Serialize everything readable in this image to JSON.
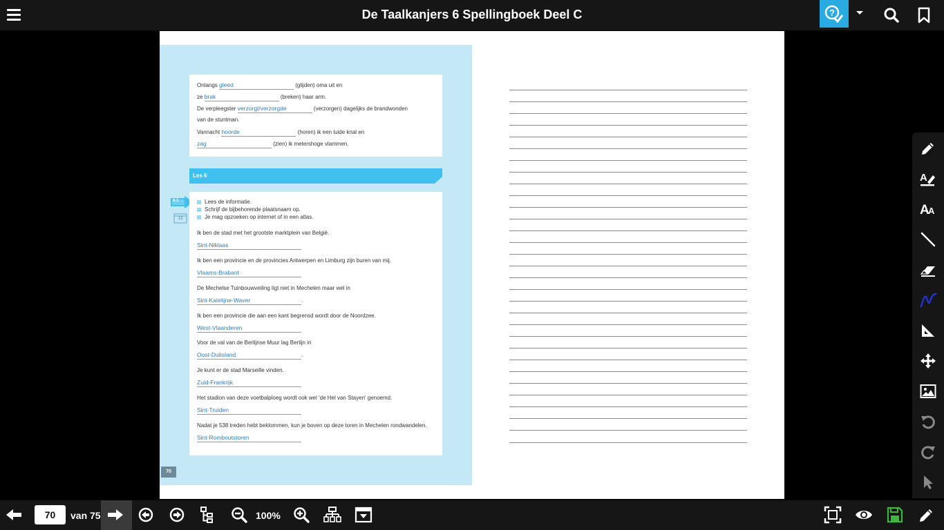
{
  "header": {
    "title": "De Taalkanjers 6 Spellingboek Deel C"
  },
  "footer": {
    "page_number": "70",
    "page_total_label": "van 75",
    "zoom_label": "100%"
  },
  "page_left": {
    "exercise_top": [
      {
        "pre": "Onlangs ",
        "answer": "gleed",
        "post": " (glijden) oma uit en"
      },
      {
        "pre": "ze ",
        "answer": "brak",
        "post": " (breken) haar arm."
      },
      {
        "pre": "De verpleegster ",
        "answer": "verzorgt/verzorgde",
        "post": " (verzorgen) dagelijks de brandwonden"
      },
      {
        "pre": "van de stuntman.",
        "answer": "",
        "post": ""
      },
      {
        "pre": "Vannacht ",
        "answer": "hoorde",
        "post": " (horen) ik een luide knal en"
      },
      {
        "pre": "",
        "answer": "zag",
        "post": " (zien) ik metershoge vlammen."
      }
    ],
    "lesson_title": "Les 6",
    "side_badge": "6.1",
    "calendar_number": "13",
    "instructions": [
      "Lees de informatie.",
      "Schrijf de bijbehorende plaatsnaam op.",
      "Je mag opzoeken op internet of in een atlas."
    ],
    "questions": [
      {
        "q": "Ik ben de stad met het grootste marktplein van België.",
        "a": "Sint-Niklaas",
        "tail": ""
      },
      {
        "q": "Ik ben een provincie en de provincies Antwerpen en Limburg zijn buren van mij.",
        "a": "Vlaams-Brabant",
        "tail": ""
      },
      {
        "q": "De Mechelse Tuinbouwveiling ligt niet in Mechelen maar wel in",
        "a": "Sint-Katelijne-Waver",
        "tail": "."
      },
      {
        "q": "Ik ben een provincie die aan een kant begrensd wordt door de Noordzee.",
        "a": "West-Vlaanderen",
        "tail": ""
      },
      {
        "q": "Voor de val van de Berlijnse Muur lag Berlijn in",
        "a": "Oost-Duitsland",
        "tail": "."
      },
      {
        "q": "Je kunt er de stad Marseille vinden.",
        "a": "Zuid-Frankrijk",
        "tail": ""
      },
      {
        "q": "Het stadion van deze voetbalploeg wordt ook wel 'de Hel van Stayen' genoemd.",
        "a": "Sint-Truiden",
        "tail": ""
      },
      {
        "q": "Nadat je 538 treden hebt beklommen, kun je boven op deze toren in Mechelen rondwandelen.",
        "a": "Sint-Romboutstoren",
        "tail": ""
      }
    ],
    "page_badge": "70"
  },
  "colors": {
    "bar": "#161616",
    "help_accent": "#29abe2",
    "panel": "#c5e8f6",
    "banner": "#3fc0ef",
    "answer": "#2f7dc0",
    "save": "#3db83d",
    "pen": "#2233cc"
  },
  "icons": {
    "top": [
      "menu-icon",
      "help-check-icon",
      "caret-down-icon",
      "search-icon",
      "bookmark-icon"
    ],
    "tools": [
      "pencil-icon",
      "highlighter-icon",
      "text-icon",
      "line-icon",
      "eraser-icon",
      "pen-color-icon",
      "triangle-ruler-icon",
      "move-icon",
      "image-icon",
      "undo-icon",
      "redo-icon",
      "pointer-icon"
    ],
    "bottom": [
      "arrow-left-icon",
      "arrow-right-icon",
      "circle-arrow-left-icon",
      "circle-arrow-right-icon",
      "sitemap-icon",
      "zoom-out-icon",
      "zoom-in-icon",
      "network-icon",
      "window-icon",
      "fit-screen-icon",
      "eye-icon",
      "save-icon",
      "pencil-icon"
    ]
  }
}
